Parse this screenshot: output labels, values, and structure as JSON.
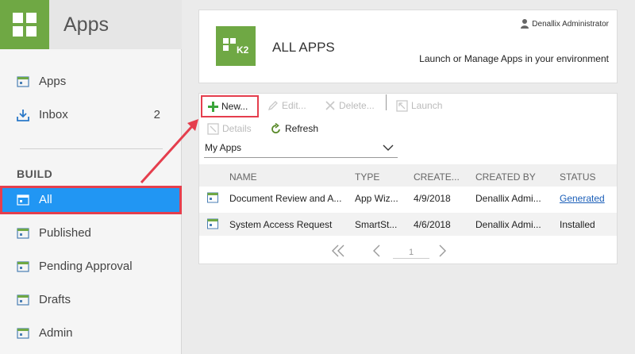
{
  "sidebar": {
    "title": "Apps",
    "nav": [
      {
        "label": "Apps",
        "count": ""
      },
      {
        "label": "Inbox",
        "count": "2"
      }
    ],
    "section_label": "BUILD",
    "build_items": [
      {
        "label": "All"
      },
      {
        "label": "Published"
      },
      {
        "label": "Pending Approval"
      },
      {
        "label": "Drafts"
      },
      {
        "label": "Admin"
      }
    ]
  },
  "header": {
    "logo_text": "K2",
    "title": "ALL APPS",
    "user": "Denallix Administrator",
    "subtitle": "Launch or Manage Apps in your environment"
  },
  "toolbar": {
    "new": "New...",
    "edit": "Edit...",
    "delete": "Delete...",
    "launch": "Launch",
    "details": "Details",
    "refresh": "Refresh"
  },
  "filter": {
    "selected": "My Apps"
  },
  "table": {
    "columns": [
      "NAME",
      "TYPE",
      "CREATE...",
      "CREATED BY",
      "STATUS"
    ],
    "rows": [
      {
        "name": "Document Review and A...",
        "type": "App Wiz...",
        "created": "4/9/2018",
        "by": "Denallix Admi...",
        "status": "Generated"
      },
      {
        "name": "System Access Request",
        "type": "SmartSt...",
        "created": "4/6/2018",
        "by": "Denallix Admi...",
        "status": "Installed"
      }
    ]
  },
  "pager": {
    "page": "1"
  },
  "colors": {
    "accent": "#6fa844",
    "selection": "#2196f3",
    "highlight": "#e53e4d",
    "link": "#1a5eb8"
  }
}
